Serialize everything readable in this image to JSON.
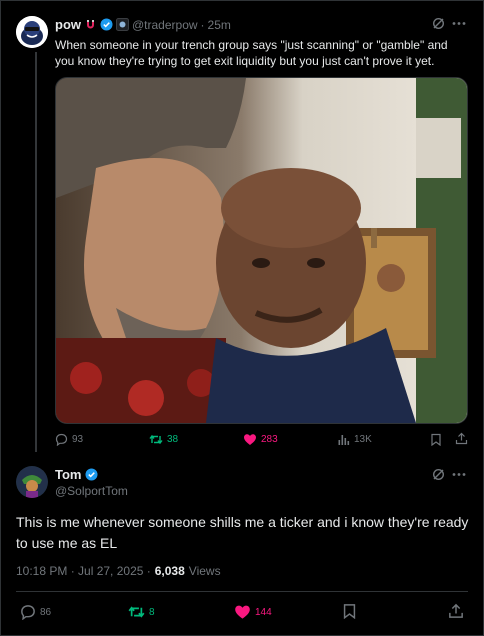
{
  "tweet1": {
    "display_name": "pow",
    "handle": "@traderpow",
    "sep": "·",
    "time": "25m",
    "text_line1": "When someone in your trench group says \"just scanning\" or \"gamble\" and",
    "text_line2": "you know they're trying to get exit liquidity but you just can't prove it yet.",
    "stats": {
      "replies": "93",
      "reposts": "38",
      "likes": "283",
      "views": "13K"
    }
  },
  "tweet2": {
    "display_name": "Tom",
    "handle": "@SolportTom",
    "text_line1": "This is me whenever someone shills me a ticker and i know they're ready",
    "text_line2": "to use me as EL",
    "timestamp": "10:18 PM · Jul 27, 2025 ·",
    "views_count": "6,038",
    "views_label": "Views",
    "stats": {
      "replies": "86",
      "reposts": "8",
      "likes": "144"
    }
  },
  "colors": {
    "verified": "#1d9bf0",
    "repost": "#00ba7c",
    "like": "#f91880",
    "muted": "#71767b",
    "text": "#e7e9ea"
  },
  "icons": [
    "grok-icon",
    "more-icon",
    "reply-icon",
    "repost-icon",
    "heart-icon",
    "views-icon",
    "bookmark-icon",
    "share-icon",
    "verified-badge-icon"
  ]
}
